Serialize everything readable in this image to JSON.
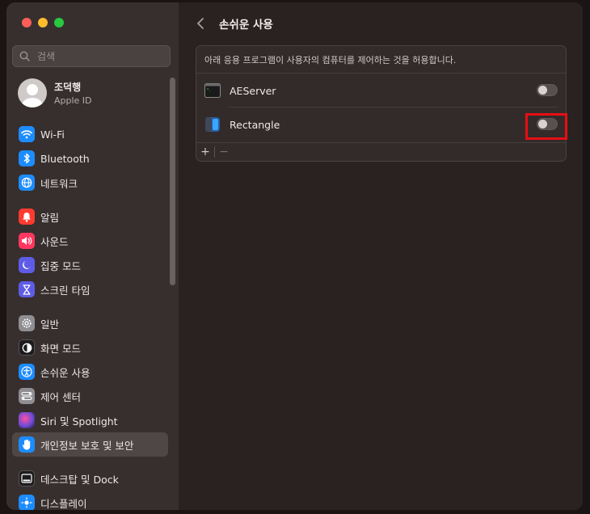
{
  "sidebar": {
    "search": {
      "placeholder": "검색",
      "value": ""
    },
    "profile": {
      "name": "조덕행",
      "subtitle": "Apple ID"
    },
    "groups": [
      [
        {
          "label": "Wi-Fi",
          "icon": "wifi-icon",
          "color": "#1d8cff"
        },
        {
          "label": "Bluetooth",
          "icon": "bluetooth-icon",
          "color": "#1d8cff"
        },
        {
          "label": "네트워크",
          "icon": "globe-icon",
          "color": "#1d8cff"
        }
      ],
      [
        {
          "label": "알림",
          "icon": "bell-icon",
          "color": "#ff3b30"
        },
        {
          "label": "사운드",
          "icon": "speaker-icon",
          "color": "#ff375f"
        },
        {
          "label": "집중 모드",
          "icon": "moon-icon",
          "color": "#5e5ce6"
        },
        {
          "label": "스크린 타임",
          "icon": "hourglass-icon",
          "color": "#5e5ce6"
        }
      ],
      [
        {
          "label": "일반",
          "icon": "gear-icon",
          "color": "#8e8e93"
        },
        {
          "label": "화면 모드",
          "icon": "appearance-icon",
          "color": "#1c1c1e"
        },
        {
          "label": "손쉬운 사용",
          "icon": "accessibility-icon",
          "color": "#1d8cff"
        },
        {
          "label": "제어 센터",
          "icon": "control-center-icon",
          "color": "#8e8e93"
        },
        {
          "label": "Siri 및 Spotlight",
          "icon": "siri-icon",
          "color": "#6e4bd6"
        },
        {
          "label": "개인정보 보호 및 보안",
          "icon": "hand-icon",
          "color": "#1d8cff",
          "active": true
        }
      ],
      [
        {
          "label": "데스크탑 및 Dock",
          "icon": "dock-icon",
          "color": "#1c1c1e"
        },
        {
          "label": "디스플레이",
          "icon": "display-icon",
          "color": "#1d8cff"
        }
      ]
    ]
  },
  "main": {
    "title": "손쉬운 사용",
    "description": "아래 응용 프로그램이 사용자의 컴퓨터를 제어하는 것을 허용합니다.",
    "apps": [
      {
        "name": "AEServer",
        "icon": "terminal-app-icon",
        "enabled": false
      },
      {
        "name": "Rectangle",
        "icon": "rectangle-app-icon",
        "enabled": false
      }
    ],
    "add_label": "+",
    "remove_label": "−"
  },
  "colors": {
    "accent": "#1d8cff",
    "highlight": "#e60e14"
  }
}
